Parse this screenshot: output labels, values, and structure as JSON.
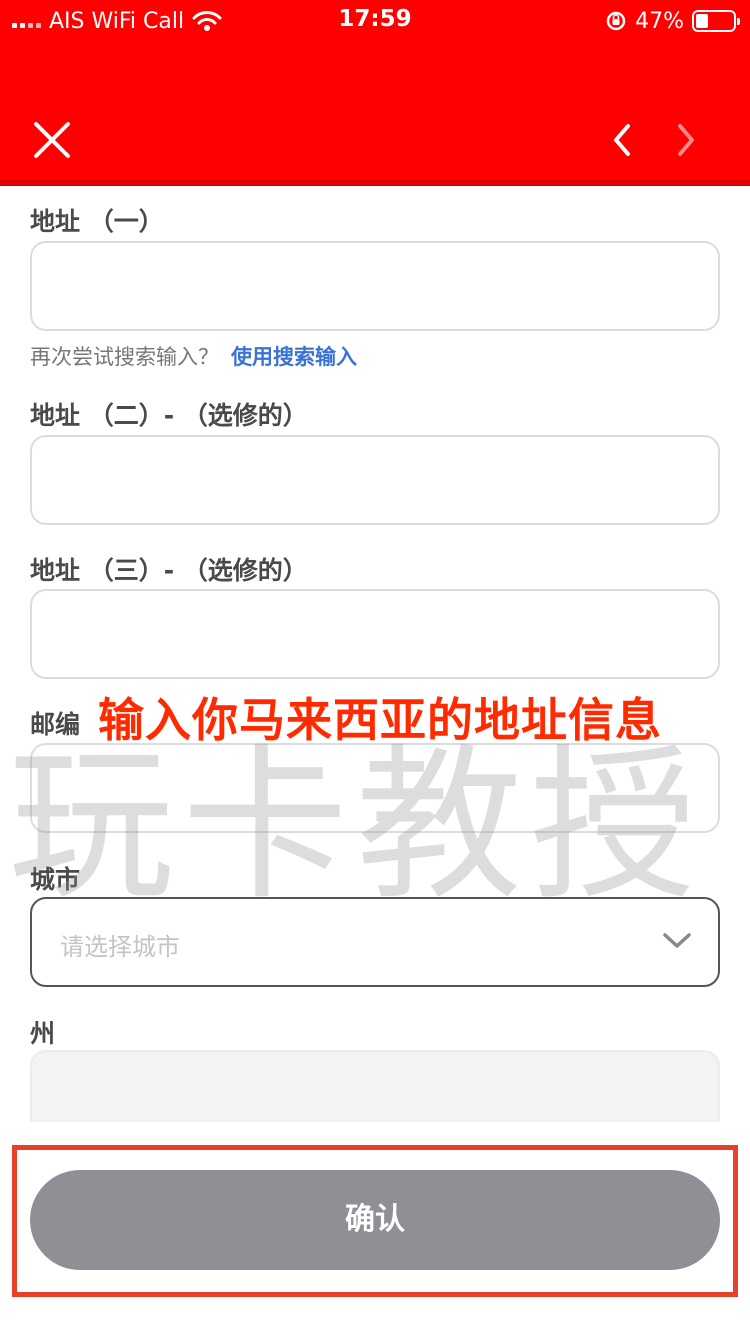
{
  "status_bar": {
    "carrier": "AIS WiFi Call",
    "time": "17:59",
    "battery": "47%",
    "battery_level": 0.47
  },
  "header": {
    "close_icon": "close-icon",
    "prev_icon": "chevron-left-icon",
    "next_icon": "chevron-right-icon",
    "background_color": "#ff0000"
  },
  "form": {
    "address1_label": "地址 （一）",
    "address1_value": "",
    "retry_hint": "再次尝试搜索输入？",
    "use_search_link": "使用搜索输入",
    "address2_label": "地址 （二）- （选修的）",
    "address2_value": "",
    "address3_label": "地址 （三）- （选修的）",
    "address3_value": "",
    "postcode_label": "邮编",
    "postcode_value": "",
    "city_label": "城市",
    "city_placeholder": "请选择城市",
    "state_label": "州",
    "state_value": ""
  },
  "overlay": {
    "annotation": "输入你马来西亚的地址信息",
    "watermark": "玩卡教授",
    "annotation_color": "#ff2a00"
  },
  "footer": {
    "confirm_label": "确认",
    "confirm_color": "#8f8f96",
    "highlight_color": "#e8412a"
  }
}
